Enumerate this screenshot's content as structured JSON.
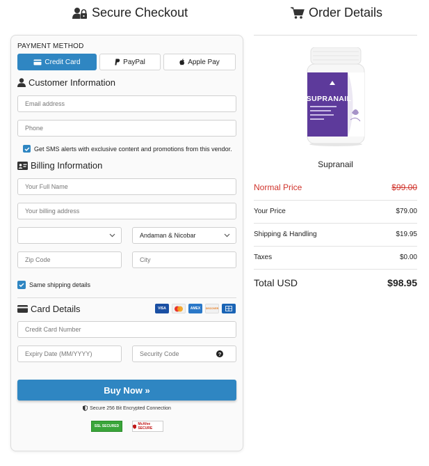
{
  "left_header": {
    "title": "Secure Checkout",
    "icon": "user-lock-icon"
  },
  "right_header": {
    "title": "Order Details",
    "icon": "shopping-cart-icon"
  },
  "payment": {
    "label": "PAYMENT METHOD",
    "tabs": [
      {
        "label": "Credit Card",
        "icon": "credit-card-icon",
        "active": true
      },
      {
        "label": "PayPal",
        "icon": "paypal-icon",
        "active": false
      },
      {
        "label": "Apple Pay",
        "icon": "apple-icon",
        "active": false
      }
    ]
  },
  "customer": {
    "heading": "Customer Information",
    "email_placeholder": "Email address",
    "phone_placeholder": "Phone",
    "sms_label": "Get SMS alerts with exclusive content and promotions from this vendor.",
    "sms_checked": true
  },
  "billing": {
    "heading": "Billing Information",
    "name_placeholder": "Your Full Name",
    "address_placeholder": "Your billing address",
    "country_value": "",
    "state_value": "Andaman & Nicobar",
    "zip_placeholder": "Zip Code",
    "city_placeholder": "City",
    "same_shipping_label": "Same shipping details",
    "same_shipping_checked": true
  },
  "card": {
    "heading": "Card Details",
    "logos": [
      "VISA",
      "MC",
      "AMEX",
      "DISCOVER",
      "DINERS"
    ],
    "number_placeholder": "Credit Card Number",
    "expiry_placeholder": "Expiry Date (MM/YYYY)",
    "cvv_placeholder": "Security Code"
  },
  "buy_button": "Buy Now »",
  "secure_text": "Secure 256 Bit Encrypted Connection",
  "badges": {
    "ssl": "SSL SECURED",
    "mcafee": "McAfee SECURE"
  },
  "product": {
    "name": "Supranail",
    "label_text": "SUPRANAIL"
  },
  "order_rows": [
    {
      "label": "Normal Price",
      "amount": "$99.00"
    },
    {
      "label": "Your Price",
      "amount": "$79.00"
    },
    {
      "label": "Shipping & Handling",
      "amount": "$19.95"
    },
    {
      "label": "Taxes",
      "amount": "$0.00"
    },
    {
      "label": "Total USD",
      "amount": "$98.95"
    }
  ],
  "colors": {
    "accent": "#2f86c2",
    "strike_red": "#d0342c",
    "secure_green": "#3aa53a"
  }
}
